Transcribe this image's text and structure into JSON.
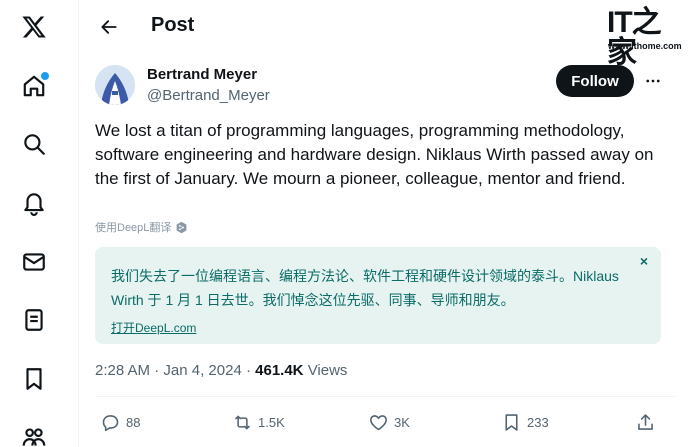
{
  "header": {
    "title": "Post",
    "back_icon": "arrow-left-icon"
  },
  "sidebar": {
    "logo_icon": "x-logo-icon",
    "items": [
      {
        "name": "home",
        "icon": "home-icon"
      },
      {
        "name": "explore",
        "icon": "search-icon"
      },
      {
        "name": "notifications",
        "icon": "bell-icon"
      },
      {
        "name": "messages",
        "icon": "envelope-icon"
      },
      {
        "name": "lists",
        "icon": "list-icon"
      },
      {
        "name": "bookmarks",
        "icon": "bookmark-icon"
      },
      {
        "name": "communities",
        "icon": "people-icon"
      }
    ],
    "notification_dot_color": "#1d9bf0"
  },
  "watermark": {
    "logo": "IT之家",
    "url": "www.ithome.com"
  },
  "post": {
    "author_name": "Bertrand Meyer",
    "author_handle": "@Bertrand_Meyer",
    "follow_label": "Follow",
    "text": "We lost a titan of programming languages, programming methodology, software engineering and hardware design. Niklaus Wirth passed away on the first of January. We mourn a pioneer, colleague, mentor and friend.",
    "translate_label": "使用DeepL翻译",
    "translation": {
      "text": "我们失去了一位编程语言、编程方法论、软件工程和硬件设计领域的泰斗。Niklaus Wirth 于 1 月 1 日去世。我们悼念这位先驱、同事、导师和朋友。",
      "close_label": "×",
      "link_label": "打开DeepL.com"
    },
    "time": "2:28 AM",
    "separator": "·",
    "date": "Jan 4, 2024",
    "views_count": "461.4K",
    "views_label": "Views",
    "actions": {
      "replies": "88",
      "reposts": "1.5K",
      "likes": "3K",
      "bookmarks": "233"
    }
  },
  "colors": {
    "text": "#0f1419",
    "muted": "#536471",
    "translation_bg": "#e6f3f1",
    "translation_text": "#0b6b66"
  }
}
